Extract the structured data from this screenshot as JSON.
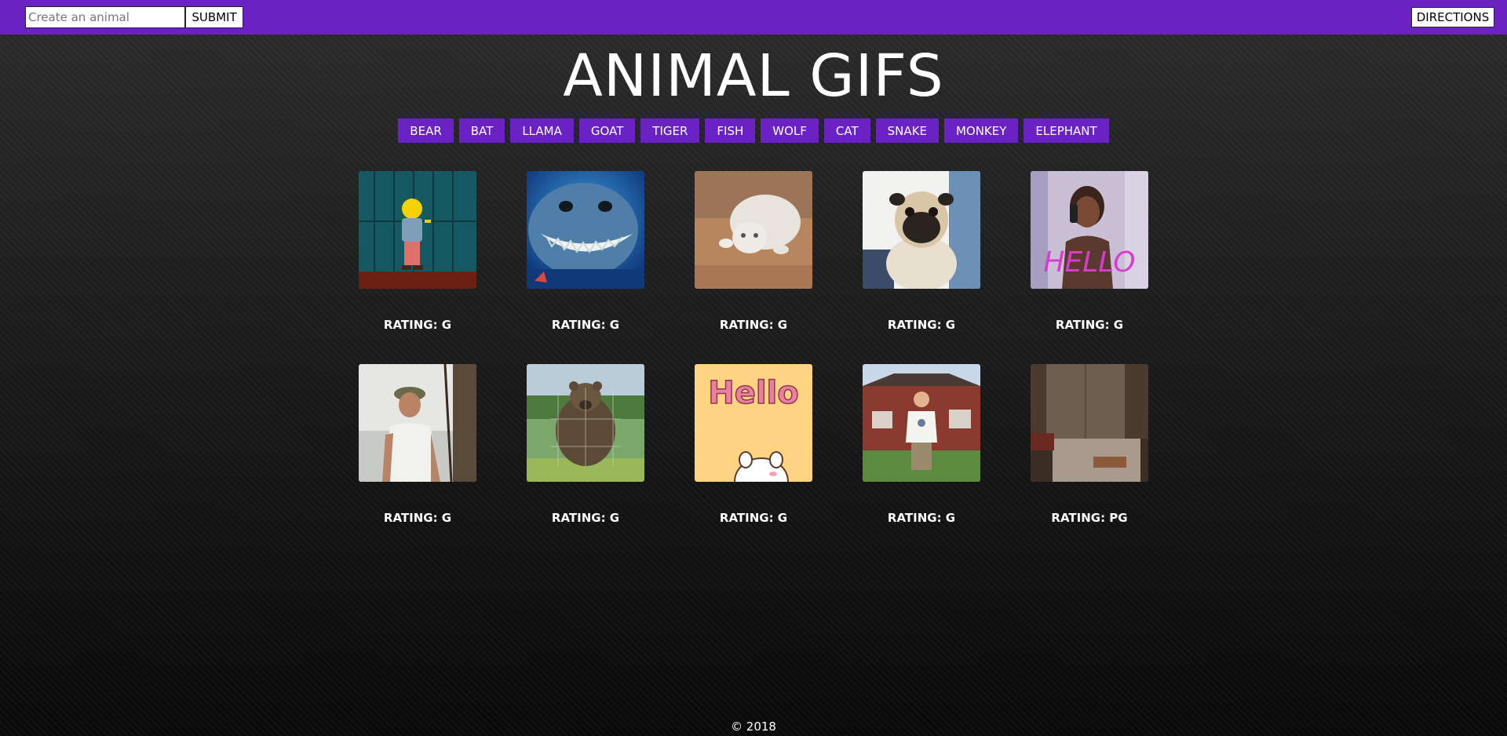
{
  "topbar": {
    "search_placeholder": "Create an animal",
    "search_value": "",
    "submit_label": "SUBMIT",
    "directions_label": "DIRECTIONS"
  },
  "page_title": "ANIMAL GIFS",
  "animal_buttons": [
    "BEAR",
    "BAT",
    "LLAMA",
    "GOAT",
    "TIGER",
    "FISH",
    "WOLF",
    "CAT",
    "SNAKE",
    "MONKEY",
    "ELEPHANT"
  ],
  "gifs": [
    {
      "rating": "RATING: G",
      "subject": "cartoon-boy-in-hallway",
      "caption": ""
    },
    {
      "rating": "RATING: G",
      "subject": "grinning-shark",
      "caption": ""
    },
    {
      "rating": "RATING: G",
      "subject": "white-kitten-on-floor",
      "caption": ""
    },
    {
      "rating": "RATING: G",
      "subject": "pug-dog",
      "caption": ""
    },
    {
      "rating": "RATING: G",
      "subject": "man-on-phone",
      "caption": "HELLO"
    },
    {
      "rating": "RATING: G",
      "subject": "man-in-hat-on-boat",
      "caption": ""
    },
    {
      "rating": "RATING: G",
      "subject": "bear-in-grass",
      "caption": ""
    },
    {
      "rating": "RATING: G",
      "subject": "cartoon-hello-card",
      "caption": "Hello"
    },
    {
      "rating": "RATING: G",
      "subject": "man-in-front-yard",
      "caption": ""
    },
    {
      "rating": "RATING: PG",
      "subject": "dim-room-with-box",
      "caption": ""
    }
  ],
  "footer": "© 2018",
  "colors": {
    "accent": "#6a22c4",
    "background_top": "#2b2b2b",
    "background_bottom": "#090909",
    "text": "#ffffff"
  }
}
